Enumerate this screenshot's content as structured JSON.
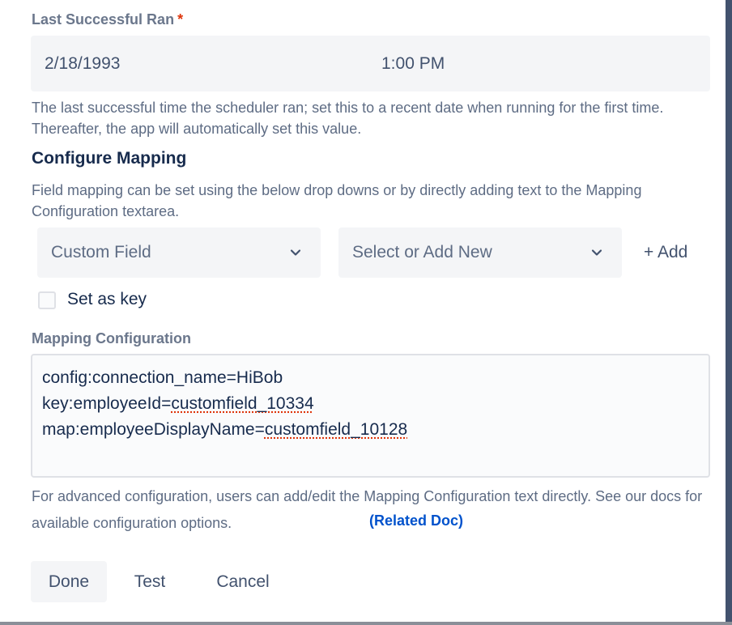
{
  "last_ran": {
    "label": "Last Successful Ran",
    "required_mark": "*",
    "date": "2/18/1993",
    "time": "1:00 PM",
    "help": "The last successful time the scheduler ran; set this to a recent date when running for the first time. Thereafter, the app will automatically set this value."
  },
  "mapping": {
    "title": "Configure Mapping",
    "help": "Field mapping can be set using the below drop downs or by directly adding text to the Mapping Configuration textarea.",
    "field_select": "Custom Field",
    "value_select": "Select or Add New",
    "add_label": "+ Add",
    "set_as_key_label": "Set as key"
  },
  "config": {
    "label": "Mapping Configuration",
    "line1": "config:connection_name=HiBob",
    "line2_key": "key:employeeId=",
    "line2_value": "customfield_10334",
    "line3_key": "map:employeeDisplayName=",
    "line3_value": "customfield_10128",
    "help": "For advanced configuration, users can add/edit the Mapping Configuration text directly. See our docs for available configuration options.",
    "related_doc": "(Related Doc)"
  },
  "buttons": {
    "done": "Done",
    "test": "Test",
    "cancel": "Cancel"
  },
  "colors": {
    "accent_link": "#0052cc",
    "required": "#de350b",
    "field_bg": "#f4f5f7"
  },
  "icons": {
    "dropdown": "chevron-down-icon",
    "checkbox": "checkbox-icon"
  }
}
